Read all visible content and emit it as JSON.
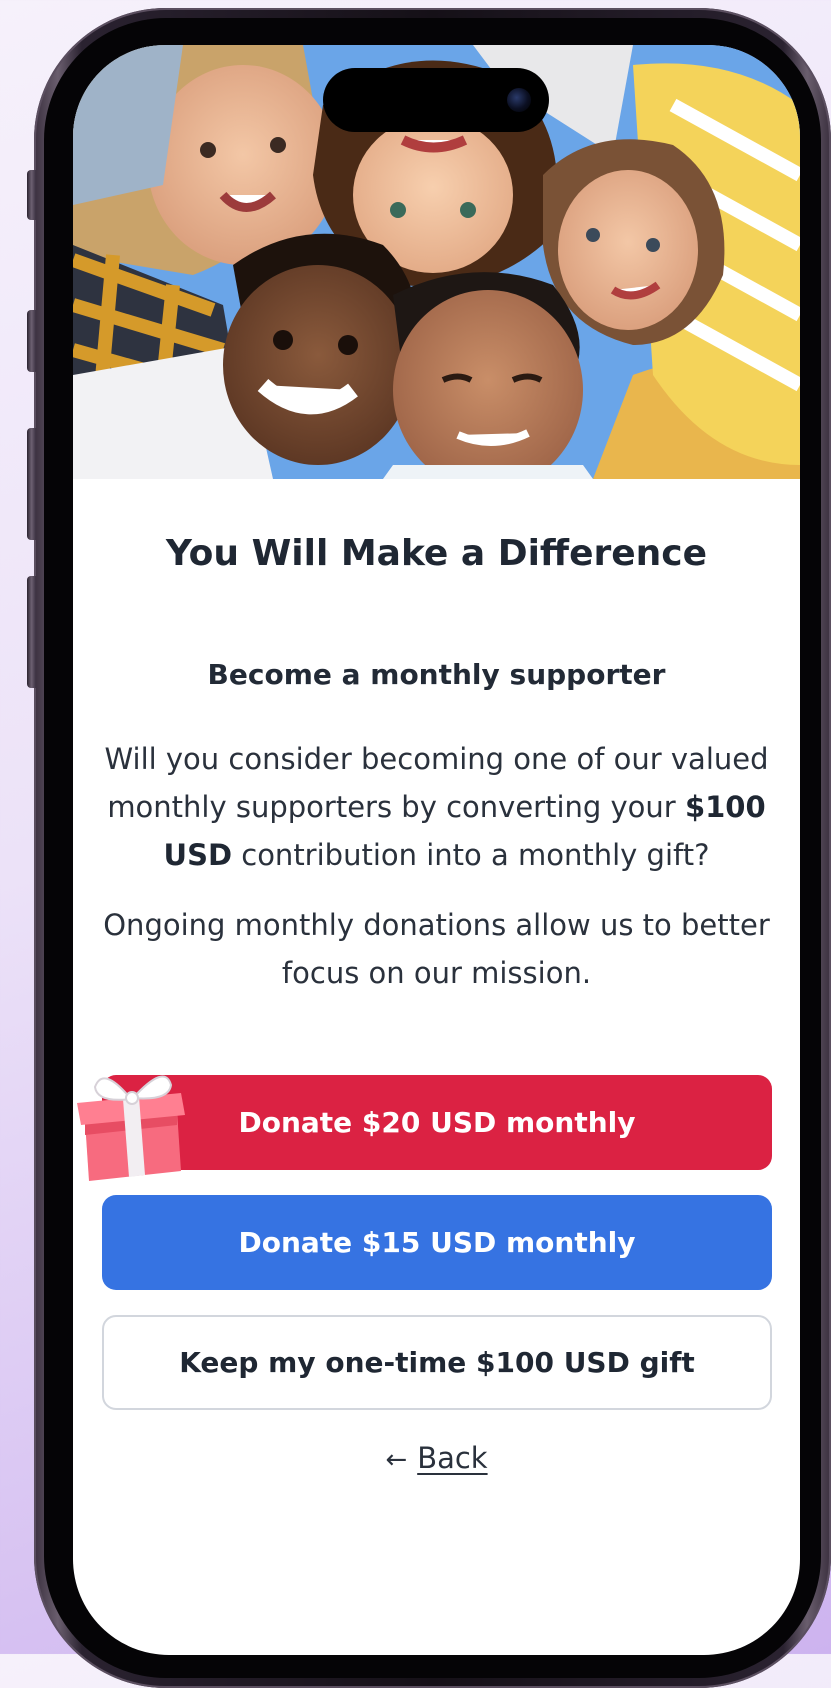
{
  "screen": {
    "headline": "You Will Make a Difference",
    "subheading": "Become a monthly supporter",
    "paragraph1": {
      "before": "Will you consider becoming one of our valued monthly supporters by converting your ",
      "amount": "$100 USD",
      "after": " contribution into a monthly gift?"
    },
    "paragraph2": "Ongoing monthly donations allow us to better focus on our mission.",
    "buttons": {
      "primary": "Donate $20 USD monthly",
      "secondary": "Donate $15 USD monthly",
      "keep": "Keep my one-time $100 USD gift"
    },
    "back": {
      "arrow": "←",
      "label": "Back"
    }
  },
  "icons": {
    "gift": "gift-icon",
    "back_arrow": "arrow-left-icon"
  },
  "colors": {
    "primary_button": "#db2243",
    "secondary_button": "#3673e2",
    "outline_border": "#d2d6dd",
    "text": "#1f2733"
  }
}
